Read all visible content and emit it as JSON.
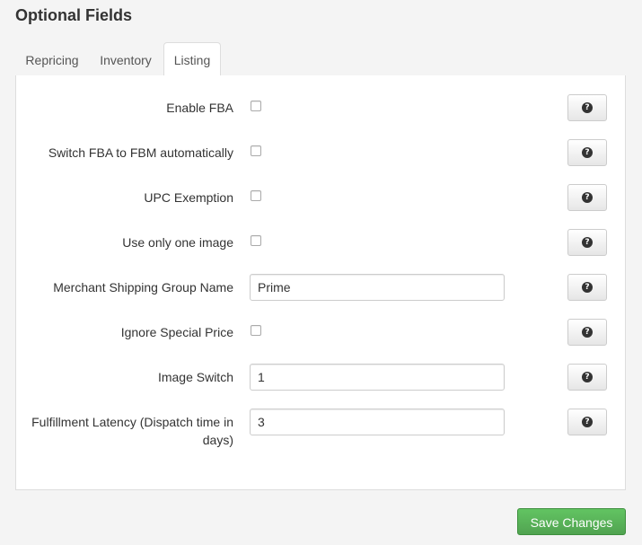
{
  "section": {
    "title": "Optional Fields"
  },
  "tabs": [
    {
      "label": "Repricing",
      "active": false
    },
    {
      "label": "Inventory",
      "active": false
    },
    {
      "label": "Listing",
      "active": true
    }
  ],
  "fields": [
    {
      "label": "Enable FBA",
      "type": "checkbox",
      "checked": false
    },
    {
      "label": "Switch FBA to FBM automatically",
      "type": "checkbox",
      "checked": false
    },
    {
      "label": "UPC Exemption",
      "type": "checkbox",
      "checked": false
    },
    {
      "label": "Use only one image",
      "type": "checkbox",
      "checked": false
    },
    {
      "label": "Merchant Shipping Group Name",
      "type": "text",
      "value": "Prime"
    },
    {
      "label": "Ignore Special Price",
      "type": "checkbox",
      "checked": false
    },
    {
      "label": "Image Switch",
      "type": "text",
      "value": "1"
    },
    {
      "label": "Fulfillment Latency (Dispatch time in days)",
      "type": "text",
      "value": "3"
    }
  ],
  "help_icon": {
    "name": "question-circle-icon",
    "glyph": "?"
  },
  "actions": {
    "save_label": "Save Changes"
  },
  "colors": {
    "save_button": "#5cb85c",
    "panel_border": "#dddddd",
    "background": "#f4f4f4"
  }
}
